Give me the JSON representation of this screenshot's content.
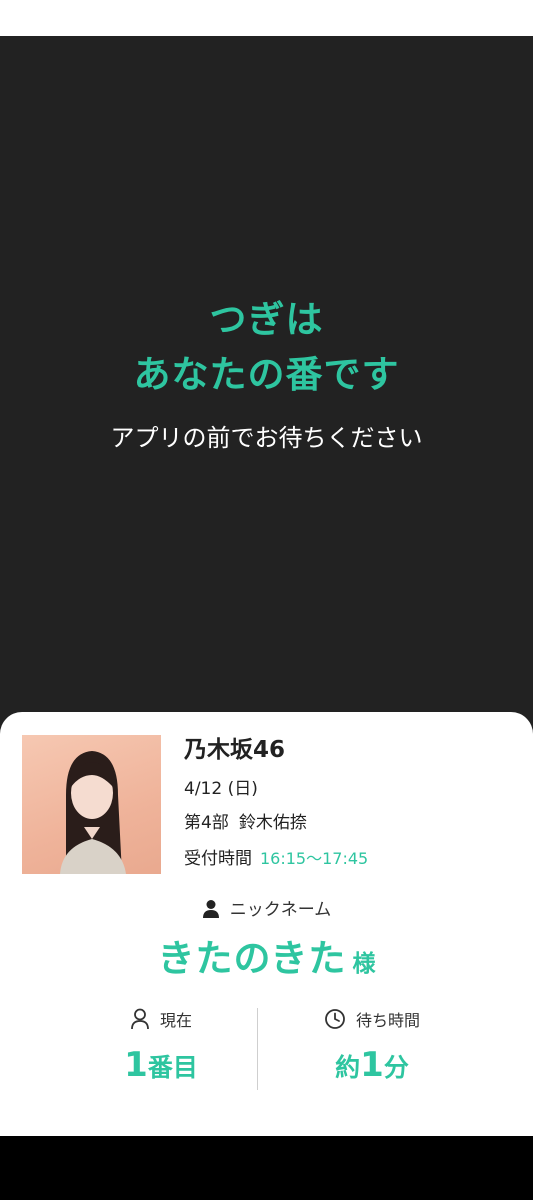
{
  "notice": {
    "line1": "つぎは",
    "line2": "あなたの番です",
    "instruction": "アプリの前でお待ちください"
  },
  "ticket": {
    "group": "乃木坂46",
    "date": "4/12 (日)",
    "part": "第4部",
    "member": "鈴木佑捺",
    "reception_label": "受付時間",
    "reception_time": "16:15〜17:45",
    "nickname_label": "ニックネーム",
    "nickname": "きたのきた",
    "honorific": "様"
  },
  "status": {
    "current_label": "現在",
    "current_number": "1",
    "current_suffix": "番目",
    "wait_label": "待ち時間",
    "wait_prefix": "約",
    "wait_number": "1",
    "wait_suffix": "分"
  },
  "icons": {
    "person": "person-icon",
    "user_outline": "user-outline-icon",
    "clock": "clock-icon"
  },
  "colors": {
    "accent": "#2ec5a0",
    "dark_bg": "#222222"
  }
}
